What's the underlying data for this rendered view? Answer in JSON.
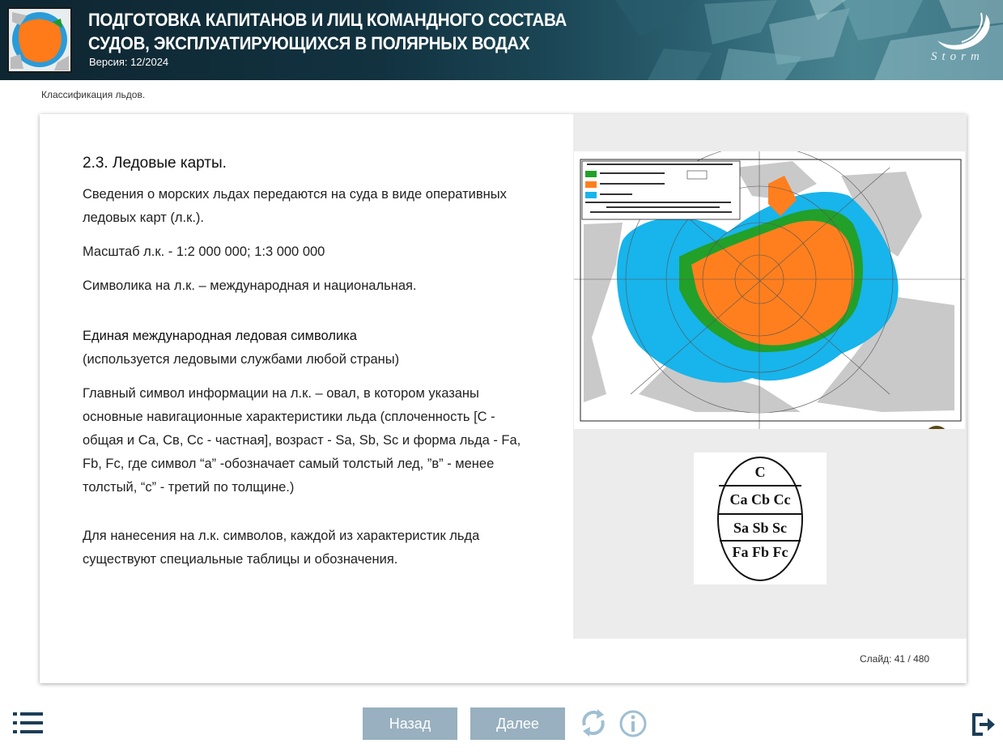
{
  "header": {
    "title": "ПОДГОТОВКА КАПИТАНОВ И ЛИЦ КОМАНДНОГО СОСТАВА СУДОВ, ЭКСПЛУАТИРУЮЩИХСЯ В ПОЛЯРНЫХ ВОДАХ",
    "version": "Версия: 12/2024",
    "brand": "Storm"
  },
  "breadcrumb": "Классификация льдов.",
  "slide": {
    "heading": "2.3. Ледовые карты.",
    "p1": "Сведения о морских льдах передаются на суда в виде оперативных ледовых карт (л.к.).",
    "p2": "Масштаб  л.к. - 1:2 000 000; 1:3 000 000",
    "p3": "Символика на л.к. – международная и национальная.",
    "subheading": "Единая международная ледовая символика",
    "p4": "(используется ледовыми службами любой страны)",
    "p5": "Главный символ информации на л.к. – овал, в котором указаны основные навигационные характеристики льда  (сплоченность [С - общая и Са, Св, Сс - частная], возраст - Sa, Sb, Sc  и форма льда - Fa, Fb, Fc, где символ  “a” -обозначает самый толстый лед, ”в” - менее толстый, “с” - третий по толщине.)",
    "p6": "Для нанесения на л.к. символов, каждой из характеристик  льда существуют специальные таблицы и обозначения."
  },
  "oval": {
    "row1": "C",
    "row2": "Ca Cb Cc",
    "row3": "Sa  Sb  Sc",
    "row4": "Fa Fb Fc"
  },
  "counter": {
    "label": "Слайд:",
    "current": "41",
    "total": "480",
    "text": "Слайд:  41 / 480"
  },
  "nav": {
    "back_label": "Назад",
    "next_label": "Далее"
  },
  "icons": {
    "menu": "list-menu-icon",
    "reload": "reload-icon",
    "info": "info-icon",
    "exit": "exit-icon",
    "zoom": "zoom-in-icon"
  },
  "colors": {
    "nav_button": "#98b0bf",
    "icon_blue": "#9fbfd2",
    "dark_icon": "#1c3d57",
    "map_orange": "#ff7f1e",
    "map_green": "#22a02a",
    "map_cyan": "#18b4ec",
    "zoom_icon": "#5c4a14"
  }
}
